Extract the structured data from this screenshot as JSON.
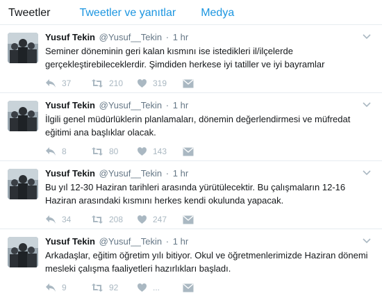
{
  "tabs": [
    {
      "label": "Tweetler"
    },
    {
      "label": "Tweetler ve yanıtlar"
    },
    {
      "label": "Medya"
    }
  ],
  "tweets": [
    {
      "name": "Yusuf Tekin",
      "handle": "@Yusuf__Tekin",
      "separator": "·",
      "time": "1 hr",
      "text": "Seminer döneminin geri kalan kısmını ise istedikleri il/ilçelerde gerçekleştirebileceklerdir. Şimdiden herkese iyi tatiller ve iyi bayramlar",
      "replies": "37",
      "retweets": "210",
      "likes": "319"
    },
    {
      "name": "Yusuf Tekin",
      "handle": "@Yusuf__Tekin",
      "separator": "·",
      "time": "1 hr",
      "text": "İlgili genel müdürlüklerin planlamaları, dönemin değerlendirmesi ve müfredat eğitimi ana başlıklar olacak.",
      "replies": "8",
      "retweets": "80",
      "likes": "143"
    },
    {
      "name": "Yusuf Tekin",
      "handle": "@Yusuf__Tekin",
      "separator": "·",
      "time": "1 hr",
      "text": "Bu yıl 12-30 Haziran tarihleri arasında yürütülecektir. Bu çalışmaların 12-16 Haziran arasındaki kısmını herkes kendi okulunda yapacak.",
      "replies": "34",
      "retweets": "208",
      "likes": "247"
    },
    {
      "name": "Yusuf Tekin",
      "handle": "@Yusuf__Tekin",
      "separator": "·",
      "time": "1 hr",
      "text": "Arkadaşlar, eğitim öğretim yılı bitiyor. Okul ve öğretmenlerimizde Haziran dönemi mesleki çalışma faaliyetleri hazırlıkları başladı.",
      "replies": "9",
      "retweets": "92",
      "likes": "..."
    }
  ],
  "colors": {
    "accent": "#1b95e0",
    "muted": "#657786",
    "icon": "#aab8c2",
    "text": "#14171a"
  },
  "icons": {
    "reply": "reply-icon",
    "retweet": "retweet-icon",
    "like": "heart-icon",
    "dm": "envelope-icon",
    "more": "chevron-down-icon"
  }
}
